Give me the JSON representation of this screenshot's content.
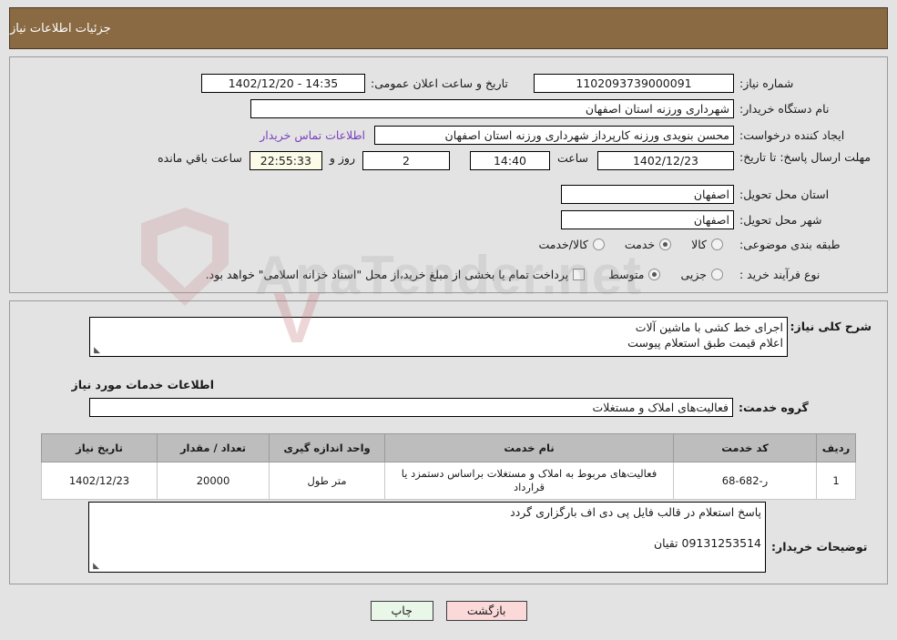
{
  "header": {
    "title": "جزئیات اطلاعات نیاز"
  },
  "watermark": {
    "text": "AnaTender.net"
  },
  "form": {
    "need_number_label": "شماره نیاز:",
    "need_number_value": "1102093739000091",
    "announce_label": "تاریخ و ساعت اعلان عمومی:",
    "announce_value": "14:35 - 1402/12/20",
    "buyer_org_label": "نام دستگاه خریدار:",
    "buyer_org_value": "شهرداری ورزنه استان اصفهان",
    "creator_label": "ایجاد کننده درخواست:",
    "creator_value": "محسن بنویدی ورزنه کارپرداز شهرداری ورزنه استان اصفهان",
    "contact_link": "اطلاعات تماس خریدار",
    "deadline_label": "مهلت ارسال پاسخ: تا تاریخ:",
    "deadline_date": "1402/12/23",
    "hour_label": "ساعت",
    "deadline_time": "14:40",
    "days_remaining": "2",
    "days_and_label": "روز و",
    "time_remaining": "22:55:33",
    "remaining_suffix_label": "ساعت باقي مانده",
    "province_label": "استان محل تحویل:",
    "province_value": "اصفهان",
    "city_label": "شهر محل تحویل:",
    "city_value": "اصفهان",
    "category_label": "طبقه بندی موضوعی:",
    "category_options": [
      "کالا",
      "خدمت",
      "کالا/خدمت"
    ],
    "category_selected_index": 1,
    "process_label": "نوع فرآیند خرید :",
    "process_options": [
      "جزیی",
      "متوسط"
    ],
    "process_selected_index": 1,
    "treasury_checkbox_checked": false,
    "treasury_note": "پرداخت تمام یا بخشی از مبلغ خرید،از محل \"اسناد خزانه اسلامی\" خواهد بود."
  },
  "description": {
    "label": "شرح کلی نیاز:",
    "value": "اجرای خط کشی با ماشین آلات\nاعلام قیمت طبق استعلام پیوست"
  },
  "services_section": {
    "heading": "اطلاعات خدمات مورد نیاز",
    "group_label": "گروه خدمت:",
    "group_value": "فعالیت‌های  املاک و مستغلات"
  },
  "items_table": {
    "columns": [
      "ردیف",
      "کد خدمت",
      "نام خدمت",
      "واحد اندازه گیری",
      "تعداد / مقدار",
      "تاریخ نیاز"
    ],
    "rows": [
      {
        "radif": "1",
        "code": "ر-682-68",
        "name": "فعالیت‌های مربوط به املاک و مستغلات براساس دستمزد یا قرارداد",
        "unit": "متر طول",
        "quantity": "20000",
        "date": "1402/12/23"
      }
    ]
  },
  "buyer_notes": {
    "label": "توضیحات خریدار:",
    "value": "پاسخ استعلام در قالب فایل پی  دی اف بارگزاری گردد\n\n09131253514 تقیان"
  },
  "buttons": {
    "print": "چاپ",
    "back": "بازگشت"
  },
  "icons": {
    "resize_grip": "◣"
  }
}
